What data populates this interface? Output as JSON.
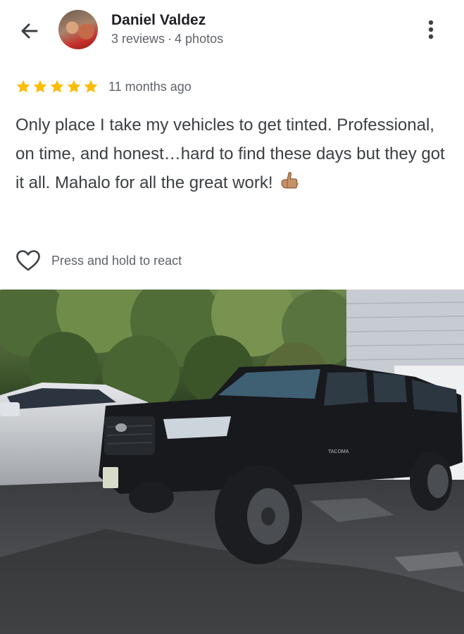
{
  "reviewer": {
    "name": "Daniel Valdez",
    "reviews": "3 reviews",
    "separator": "·",
    "photos": "4 photos"
  },
  "review": {
    "rating": 5,
    "time": "11 months ago",
    "text": "Only place I take my vehicles to get tinted. Professional, on time, and honest…hard to find these days but they got it all. Mahalo for all the great work!",
    "emoji": "call-me-hand-emoji"
  },
  "react": {
    "label": "Press and hold to react"
  },
  "photo": {
    "subject": "black pickup truck parked on driveway",
    "badge_text": "TACOMA"
  },
  "colors": {
    "star": "#fbbc04",
    "text": "#3c4043",
    "secondary": "#5f6368"
  }
}
